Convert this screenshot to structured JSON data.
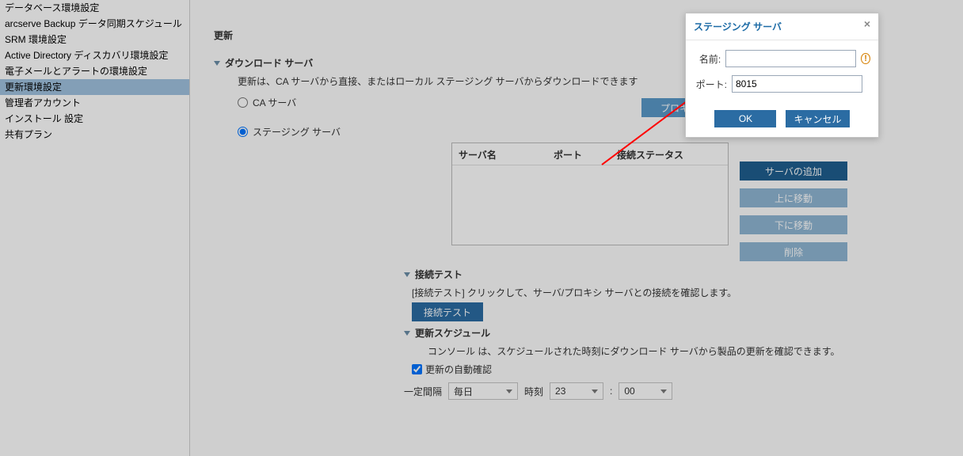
{
  "sidebar": {
    "items": [
      {
        "label": "データベース環境設定"
      },
      {
        "label": "arcserve Backup データ同期スケジュール"
      },
      {
        "label": "SRM 環境設定"
      },
      {
        "label": "Active Directory ディスカバリ環境設定"
      },
      {
        "label": "電子メールとアラートの環境設定"
      },
      {
        "label": "更新環境設定"
      },
      {
        "label": "管理者アカウント"
      },
      {
        "label": "インストール 設定"
      },
      {
        "label": "共有プラン"
      }
    ],
    "selected_index": 5
  },
  "page": {
    "title": "更新",
    "download_server": {
      "header": "ダウンロード サーバ",
      "desc": "更新は、CA サーバから直接、またはローカル ステージング サーバからダウンロードできます",
      "radio_ca": "CA サーバ",
      "radio_staging": "ステージング サーバ",
      "radio_selected": "staging",
      "proxy_btn": "プロキシ設定",
      "table": {
        "col_server": "サーバ名",
        "col_port": "ポート",
        "col_status": "接続ステータス"
      },
      "buttons": {
        "add": "サーバの追加",
        "up": "上に移動",
        "down": "下に移動",
        "delete": "削除"
      }
    },
    "conn_test": {
      "header": "接続テスト",
      "desc": "[接続テスト] クリックして、サーバ/プロキシ サーバとの接続を確認します。",
      "btn": "接続テスト"
    },
    "schedule": {
      "header": "更新スケジュール",
      "desc": "コンソール は、スケジュールされた時刻にダウンロード サーバから製品の更新を確認できます。",
      "auto_check_label": "更新の自動確認",
      "auto_check": true,
      "interval_label": "一定間隔",
      "interval_value": "毎日",
      "time_label": "時刻",
      "hour": "23",
      "sep": ":",
      "minute": "00"
    }
  },
  "dialog": {
    "title": "ステージング サーバ",
    "name_label": "名前:",
    "name_value": "",
    "port_label": "ポート:",
    "port_value": "8015",
    "ok": "OK",
    "cancel": "キャンセル"
  }
}
